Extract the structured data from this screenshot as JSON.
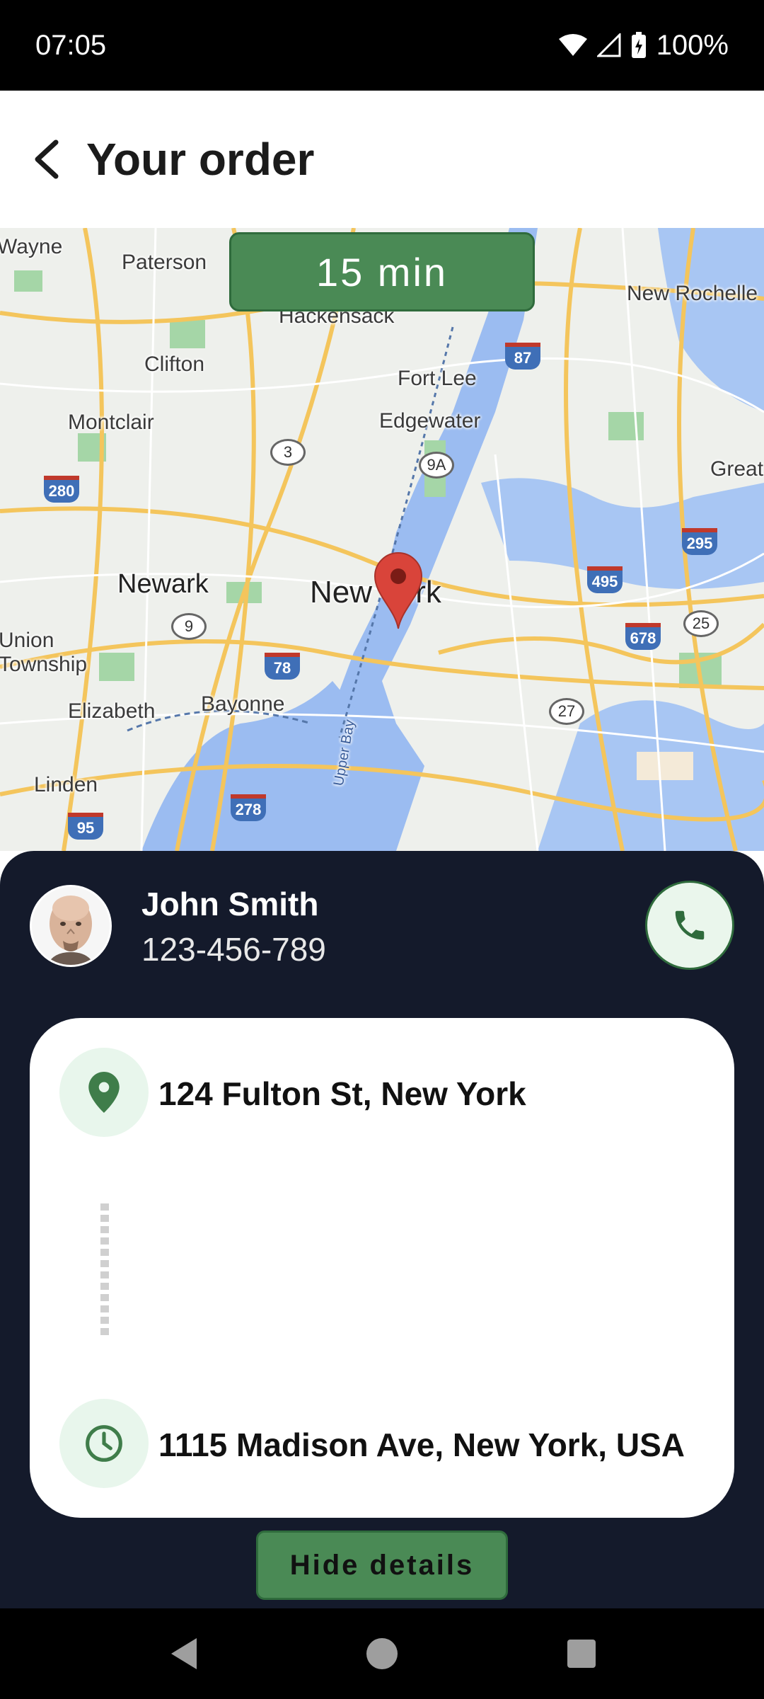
{
  "status_bar": {
    "time": "07:05",
    "battery": "100%"
  },
  "app_bar": {
    "title": "Your order"
  },
  "map": {
    "eta": "15 min",
    "places": [
      {
        "name": "Wayne"
      },
      {
        "name": "Paterson"
      },
      {
        "name": "Hackensack"
      },
      {
        "name": "New Rochelle"
      },
      {
        "name": "Clifton"
      },
      {
        "name": "Fort Lee"
      },
      {
        "name": "Montclair"
      },
      {
        "name": "Edgewater"
      },
      {
        "name": "Great"
      },
      {
        "name": "Newark"
      },
      {
        "name": "New York"
      },
      {
        "name": "Union Township"
      },
      {
        "name": "Elizabeth"
      },
      {
        "name": "Bayonne"
      },
      {
        "name": "Linden"
      },
      {
        "name": "Upper Bay"
      }
    ],
    "highways": [
      "87",
      "3",
      "9A",
      "280",
      "295",
      "495",
      "25",
      "9",
      "678",
      "78",
      "27",
      "278",
      "95"
    ]
  },
  "driver": {
    "name": "John Smith",
    "phone": "123-456-789"
  },
  "route": {
    "pickup": "124 Fulton St, New York",
    "dropoff": "1115 Madison Ave, New York, USA"
  },
  "actions": {
    "hide_details": "Hide details"
  },
  "colors": {
    "accent_green": "#4a8a55",
    "sheet_bg": "#141a2b",
    "pin_red": "#d9443a"
  }
}
